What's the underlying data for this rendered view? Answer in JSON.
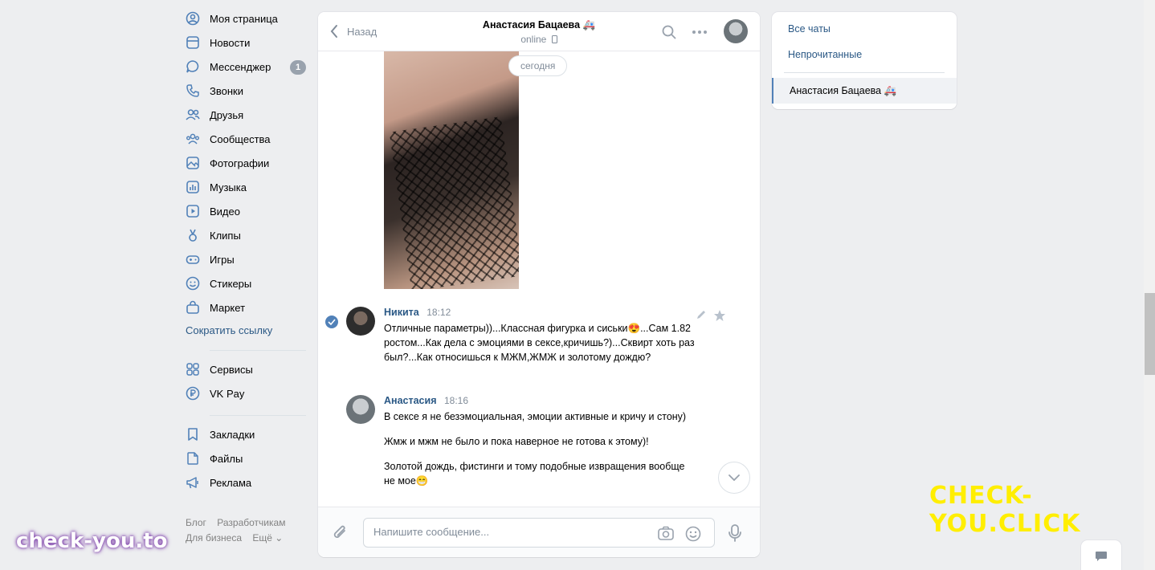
{
  "nav": {
    "items": [
      {
        "label": "Моя страница",
        "icon": "user-circle-icon"
      },
      {
        "label": "Новости",
        "icon": "news-icon"
      },
      {
        "label": "Мессенджер",
        "icon": "message-icon",
        "badge": "1"
      },
      {
        "label": "Звонки",
        "icon": "phone-icon"
      },
      {
        "label": "Друзья",
        "icon": "friends-icon"
      },
      {
        "label": "Сообщества",
        "icon": "communities-icon"
      },
      {
        "label": "Фотографии",
        "icon": "photos-icon"
      },
      {
        "label": "Музыка",
        "icon": "music-icon"
      },
      {
        "label": "Видео",
        "icon": "video-icon"
      },
      {
        "label": "Клипы",
        "icon": "clips-icon"
      },
      {
        "label": "Игры",
        "icon": "games-icon"
      },
      {
        "label": "Стикеры",
        "icon": "stickers-icon"
      },
      {
        "label": "Маркет",
        "icon": "market-icon"
      }
    ],
    "shorten_link": "Сократить ссылку",
    "items2": [
      {
        "label": "Сервисы",
        "icon": "services-icon"
      },
      {
        "label": "VK Pay",
        "icon": "vkpay-icon"
      }
    ],
    "items3": [
      {
        "label": "Закладки",
        "icon": "bookmark-icon"
      },
      {
        "label": "Файлы",
        "icon": "file-icon"
      },
      {
        "label": "Реклама",
        "icon": "ads-icon"
      }
    ],
    "footer": {
      "blog": "Блог",
      "developers": "Разработчикам",
      "business": "Для бизнеса",
      "more": "Ещё ⌄"
    }
  },
  "chat": {
    "back_label": "Назад",
    "contact_name": "Анастасия Бацаева 🚑",
    "status": "online",
    "date_pill": "сегодня",
    "messages": [
      {
        "author": "Никита",
        "time": "18:12",
        "text": [
          "Отличные параметры))...Классная фигурка и сиськи😍...Сам 1.82 ростом...Как дела с эмоциями в сексе,кричишь?)...Сквирт хоть раз был?...Как относишься к МЖМ,ЖМЖ и золотому дождю?"
        ]
      },
      {
        "author": "Анастасия",
        "time": "18:16",
        "text": [
          "В сексе я не безэмоциальная, эмоции активные и кричу и стону)",
          "Жмж и мжм не было и пока наверное не готова к этому)!",
          "Золотой дождь, фистинги и тому подобные извращения вообще не мое😁"
        ]
      }
    ],
    "input_placeholder": "Напишите сообщение..."
  },
  "right_panel": {
    "all_chats": "Все чаты",
    "unread": "Непрочитанные",
    "active_chat": "Анастасия Бацаева 🚑"
  },
  "watermarks": {
    "yellow": "CHECK-YOU.CLICK",
    "white": "check-you.to"
  },
  "colors": {
    "accent": "#5181b8",
    "link": "#2a5885",
    "background": "#edeef0",
    "watermark_yellow": "#ffee00"
  }
}
